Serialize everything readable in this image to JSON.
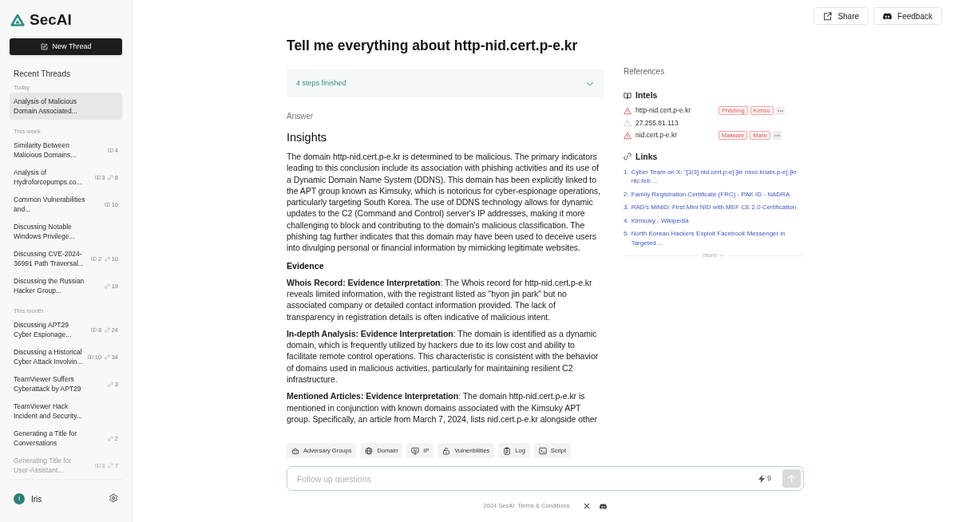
{
  "sidebar": {
    "logo": "SecAI",
    "new_thread_button": "New Thread",
    "recent_heading": "Recent Threads",
    "groups": [
      {
        "label": "Today",
        "threads": [
          {
            "title": "Analysis of Malicious Domain Associated...",
            "selected": true
          }
        ]
      },
      {
        "label": "This week",
        "threads": [
          {
            "title": "Similarity Between Malicious Domains...",
            "selected": false,
            "intels": "4"
          },
          {
            "title": "Analysis of Hydroforcepumps.co...",
            "selected": false,
            "intels": "3",
            "links": "8"
          },
          {
            "title": "Common Vulnerabilities and...",
            "selected": false,
            "intels": "10"
          },
          {
            "title": "Discussing Notable Windows Privilege...",
            "selected": false
          },
          {
            "title": "Discussing CVE-2024-36991 Path Traversal...",
            "selected": false,
            "intels": "2",
            "links": "10"
          },
          {
            "title": "Discussing the Russian Hacker Group...",
            "selected": false,
            "links": "19"
          }
        ]
      },
      {
        "label": "This month",
        "threads": [
          {
            "title": "Discussing APT29 Cyber Espionage...",
            "selected": false,
            "intels": "8",
            "links": "24"
          },
          {
            "title": "Discussing a Historical Cyber Attack Involvin...",
            "selected": false,
            "intels": "10",
            "links": "34"
          },
          {
            "title": "TeamViewer Suffers Cyberattack by APT29",
            "selected": false,
            "links": "3"
          },
          {
            "title": "TeamViewer Hack Incident and Security...",
            "selected": false
          },
          {
            "title": "Generating a Title for Conversations",
            "selected": false,
            "links": "2"
          },
          {
            "title": "Generating Title for User-Assistant...",
            "selected": false,
            "intels": "3",
            "links": "7"
          }
        ]
      }
    ],
    "user": {
      "initial": "I",
      "name": "Iris"
    }
  },
  "header": {
    "buttons": [
      {
        "label": "Share",
        "kind": "share"
      },
      {
        "label": "Feedback",
        "kind": "feedback"
      }
    ]
  },
  "question": {
    "title": "Tell me everything about http-nid.cert.p-e.kr"
  },
  "steps": {
    "label": "4 steps finished",
    "expanded": false
  },
  "answer": {
    "label": "Answer",
    "sections": [
      {
        "kind": "heading",
        "text": "Insights"
      },
      {
        "kind": "paragraph",
        "text": "The domain http-nid.cert.p-e.kr is determined to be malicious. The primary indicators leading to this conclusion include its association with phishing activities and its use of a Dynamic Domain Name System (DDNS). This domain has been explicitly linked to the APT group known as Kimsuky, which is notorious for cyber-espionage operations, particularly targeting South Korea. The use of DDNS technology allows for dynamic updates to the C2 (Command and Control) server's IP addresses, making it more challenging to block and contributing to the domain's malicious classification. The phishing tag further indicates that this domain may have been used to deceive users into divulging personal or financial information by mimicking legitimate websites."
      },
      {
        "kind": "subheading",
        "text": "Evidence"
      },
      {
        "kind": "paragraph",
        "text": "**Whois Record: Evidence Interpretation**: The Whois record for http-nid.cert.p-e.kr reveals limited information, with the registrant listed as \"hyon jin park\" but no associated company or detailed contact information provided. The lack of transparency in registration details is often indicative of malicious intent."
      },
      {
        "kind": "paragraph",
        "text": "**In-depth Analysis: Evidence Interpretation**: The domain is identified as a dynamic domain, which is frequently utilized by hackers due to its low cost and ability to facilitate remote control operations. This characteristic is consistent with the behavior of domains used in malicious activities, particularly for maintaining resilient C2 infrastructure."
      },
      {
        "kind": "paragraph",
        "text": "**Mentioned Articles: Evidence Interpretation**: The domain http-nid.cert.p-e.kr is mentioned in conjunction with known domains associated with the Kimsuky APT group. Specifically, an article from March 7, 2024, lists nid.cert.p-e.kr alongside other"
      }
    ]
  },
  "references": {
    "heading": "References",
    "intels_heading": "Intels",
    "intels": [
      {
        "value": "http-nid.cert.p-e.kr",
        "malicious": true,
        "tags": [
          "Phishing",
          "Kimsu"
        ]
      },
      {
        "value": "27.255.81.113",
        "malicious": false
      },
      {
        "value": "nid.cert.p-e.kr",
        "malicious": true,
        "tags": [
          "Malware",
          "Malw"
        ]
      }
    ],
    "links_heading": "Links",
    "links": [
      {
        "num": "1.",
        "title": "Cyber Team on X: \"[3/3] nid.cert.p-e[.]kr nsvc.knatx.p-e[.]kr ntc.feb ..."
      },
      {
        "num": "2.",
        "title": "Family Registration Certificate (FRC) - PAK ID - NADRA"
      },
      {
        "num": "3.",
        "title": "RAD's MiNID: First Mini NID with MEF CE 2.0 Certification"
      },
      {
        "num": "4.",
        "title": "Kimsuky - Wikipedia"
      },
      {
        "num": "5.",
        "title": "North Korean Hackers Exploit Facebook Messenger in Targeted ..."
      }
    ],
    "more_label": "more"
  },
  "tools": [
    {
      "label": "Adversary Groups",
      "kind": "adversary"
    },
    {
      "label": "Domain",
      "kind": "domain"
    },
    {
      "label": "IP",
      "kind": "ip"
    },
    {
      "label": "Vulneribilities",
      "kind": "vulnerability"
    },
    {
      "label": "Log",
      "kind": "log"
    },
    {
      "label": "Script",
      "kind": "script"
    }
  ],
  "followup": {
    "placeholder": "Follow up questions",
    "credits": "9"
  },
  "footer": {
    "copyright": "2024 SecAI",
    "terms_link": "Terms & Conditions"
  }
}
